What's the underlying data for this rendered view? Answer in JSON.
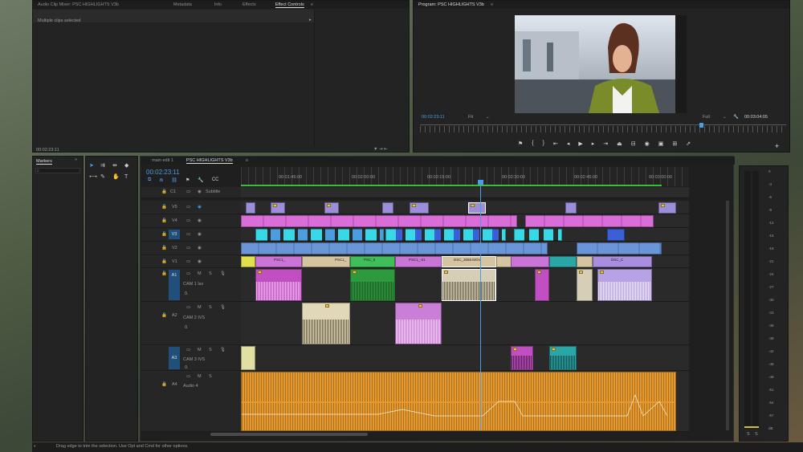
{
  "top_left_panel": {
    "tabs": [
      "Audio Clip Mixer: PSC HIGHLIGHTS V3b",
      "Metadata",
      "Info",
      "Effects",
      "Effect Controls"
    ],
    "active_tab": "Effect Controls",
    "subheader": "Multiple clips selected",
    "timecode": "00:02:23:11"
  },
  "program_monitor": {
    "title": "Program: PSC HIGHLIGHTS V3b",
    "current_time": "00:02:23:11",
    "fit": "Fit",
    "quality": "Full",
    "duration": "00:03:04:05"
  },
  "markers_panel": {
    "title": "Markers"
  },
  "timeline": {
    "tabs": [
      "main edit 1",
      "PSC HIGHLIGHTS V3b"
    ],
    "active_tab": "PSC HIGHLIGHTS V3b",
    "timecode": "00:02:23:11",
    "ruler": [
      "00:01:45:00",
      "00:02:00:00",
      "00:02:15:00",
      "00:02:30:00",
      "00:02:45:00",
      "00:03:00:00"
    ],
    "subtitle_track": {
      "id": "C1",
      "name": "Subtitle"
    },
    "video_tracks": [
      "V5",
      "V4",
      "V3",
      "V2",
      "V1"
    ],
    "audio_tracks": [
      {
        "id": "A1",
        "name": "CAM 1 lav",
        "vol": "0."
      },
      {
        "id": "A2",
        "name": "CAM 2 IVS",
        "vol": "0."
      },
      {
        "id": "A3",
        "name": "CAM 3 IVS",
        "vol": "0."
      },
      {
        "id": "A4",
        "name": "Audio 4",
        "vol": "0."
      }
    ],
    "clip_labels": [
      "PSC1_",
      "PSC_8",
      "PSC1_-01",
      "DSC_3659.MOV",
      "DSC_C"
    ],
    "mute": "M",
    "solo": "S"
  },
  "meters": {
    "scale": [
      "0",
      "-3",
      "-6",
      "-9",
      "-12",
      "-15",
      "-18",
      "-21",
      "-24",
      "-27",
      "-30",
      "-33",
      "-36",
      "-39",
      "-42",
      "-45",
      "-48",
      "-51",
      "-54",
      "-57",
      "dB"
    ],
    "solo": [
      "S",
      "S"
    ]
  },
  "status_bar": "Drag edge to trim the selection. Use Opt and Cmd for other options."
}
